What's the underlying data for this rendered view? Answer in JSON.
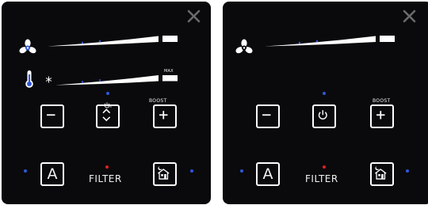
{
  "colors": {
    "panel": "#0a0a0d",
    "accent_blue": "#2f57d9",
    "accent_red": "#e02020",
    "foreground": "#ffffff",
    "close_icon": "#6a6a6e"
  },
  "labels": {
    "filter": "FILTER",
    "boost": "BOOST",
    "max": "MAX",
    "auto": "A"
  },
  "panels": [
    {
      "name": "panel-left",
      "fan_level": 0.35,
      "temperature_level": 0.35,
      "center_button": "up-down-arrows-icon"
    },
    {
      "name": "panel-right",
      "fan_level": 0.35,
      "center_button": "power-icon"
    }
  ]
}
